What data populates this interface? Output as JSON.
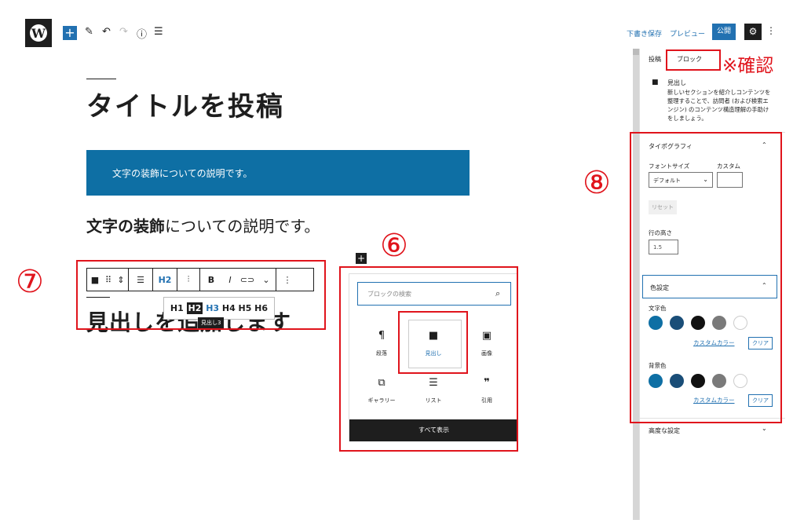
{
  "header": {
    "save_draft": "下書き保存",
    "preview": "プレビュー",
    "publish": "公開"
  },
  "editor": {
    "post_title": "タイトルを投稿",
    "blue_block_text": "文字の装飾についての説明です。",
    "paragraph_bold": "文字の装飾",
    "paragraph_rest": "についての説明です。",
    "heading_text": "見出しを追加します",
    "toolbar": {
      "heading_level": "H2"
    },
    "heading_levels": [
      "H1",
      "H2",
      "H3",
      "H4",
      "H5",
      "H6"
    ],
    "heading_level_tooltip": "見出し3"
  },
  "inserter": {
    "search_placeholder": "ブロックの検索",
    "blocks": [
      {
        "label": "段落",
        "icon": "paragraph-icon"
      },
      {
        "label": "見出し",
        "icon": "bookmark-icon"
      },
      {
        "label": "画像",
        "icon": "image-icon"
      },
      {
        "label": "ギャラリー",
        "icon": "gallery-icon"
      },
      {
        "label": "リスト",
        "icon": "list-icon"
      },
      {
        "label": "引用",
        "icon": "quote-icon"
      }
    ],
    "show_all": "すべて表示"
  },
  "sidebar": {
    "tabs": [
      "投稿",
      "ブロック"
    ],
    "block_card": {
      "title": "見出し",
      "description": "新しいセクションを紹介しコンテンツを整理することで、訪問者 (および検索エンジン) のコンテンツ構造理解の手助けをしましょう。"
    },
    "typography": {
      "title": "タイポグラフィ",
      "font_size_label": "フォントサイズ",
      "custom_label": "カスタム",
      "font_size_value": "デフォルト",
      "reset": "リセット",
      "line_height_label": "行の高さ",
      "line_height_value": "1.5"
    },
    "color": {
      "title": "色設定",
      "text_color_label": "文字色",
      "background_label": "背景色",
      "custom_color": "カスタムカラー",
      "clear": "クリア",
      "swatches": [
        "#0e6fa4",
        "#1a4e78",
        "#111111",
        "#7a7a7a",
        "#ffffff"
      ]
    },
    "advanced": "高度な設定"
  },
  "annotations": {
    "confirm": "※確認",
    "circle_6": "⑥",
    "circle_7": "⑦",
    "circle_8": "⑧"
  }
}
